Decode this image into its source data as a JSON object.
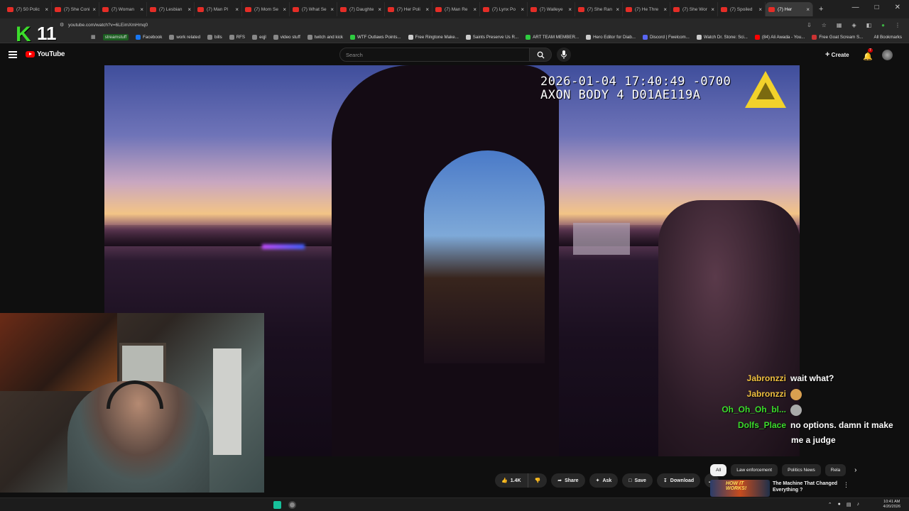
{
  "browser": {
    "tabs": [
      {
        "label": "(7) 50 Polic"
      },
      {
        "label": "(7) She Coni"
      },
      {
        "label": "(7) Woman"
      },
      {
        "label": "(7) Lesbian"
      },
      {
        "label": "(7) Man Pl"
      },
      {
        "label": "(7) Mom Se"
      },
      {
        "label": "(7) What Se"
      },
      {
        "label": "(7) Daughte"
      },
      {
        "label": "(7) Her Poli"
      },
      {
        "label": "(7) Man Re"
      },
      {
        "label": "(7) Lynx Po"
      },
      {
        "label": "(7) Walleye"
      },
      {
        "label": "(7) She Ran"
      },
      {
        "label": "(7) He Thre"
      },
      {
        "label": "(7) She Wor"
      },
      {
        "label": "(7) Spoiled"
      },
      {
        "label": "(7) Her"
      }
    ],
    "new_tab": "+",
    "url": "youtube.com/watch?v=6LEimXmHmq0",
    "bookmarks": [
      {
        "label": "streamstuff",
        "color": "#1b5e20"
      },
      {
        "label": "Facebook",
        "color": "#1877f2"
      },
      {
        "label": "work related",
        "color": "#888888"
      },
      {
        "label": "bills",
        "color": "#888888"
      },
      {
        "label": "RFS",
        "color": "#888888"
      },
      {
        "label": "eqjl",
        "color": "#888888"
      },
      {
        "label": "video stuff",
        "color": "#888888"
      },
      {
        "label": "twitch and kick",
        "color": "#888888"
      },
      {
        "label": "WTF Outlaws Points...",
        "color": "#2ecc40"
      },
      {
        "label": "Free Ringtone Make...",
        "color": "#cccccc"
      },
      {
        "label": "Saints Preserve Us R...",
        "color": "#cccccc"
      },
      {
        "label": "ART TEAM MEMBER...",
        "color": "#2ecc40"
      },
      {
        "label": "Hero Editor for Diab...",
        "color": "#cccccc"
      },
      {
        "label": "Discord | Fwelcom...",
        "color": "#5865f2"
      },
      {
        "label": "Watch Dr. Stone: Sci...",
        "color": "#cccccc"
      },
      {
        "label": "(84) Ali Awada - You...",
        "color": "#ff0000"
      },
      {
        "label": "Free Goat Scream S...",
        "color": "#cc3333"
      }
    ],
    "all_bookmarks": "All Bookmarks"
  },
  "overlay": {
    "k": "K",
    "num": "11"
  },
  "youtube": {
    "logo": "YouTube",
    "search_placeholder": "Search",
    "create_label": "Create",
    "notif_count": "7"
  },
  "video": {
    "timestamp": "2026-01-04 17:40:49 -0700",
    "device": "AXON BODY 4 D01AE119A"
  },
  "chat": [
    {
      "user": "Jabronzzi",
      "msg": "wait what?",
      "user_color": "#f0c040",
      "emote": ""
    },
    {
      "user": "Jabronzzi",
      "msg": "",
      "user_color": "#f0c040",
      "emote": "#d9a050"
    },
    {
      "user": "Oh_Oh_Oh_bl...",
      "msg": "",
      "user_color": "#3cdc2c",
      "emote": "#aaaaaa"
    },
    {
      "user": "Dolfs_Place",
      "msg": "no options. damn it make",
      "user_color": "#3cdc2c",
      "emote": ""
    },
    {
      "user": "",
      "msg": "me a judge",
      "user_color": "#ffffff",
      "emote": ""
    }
  ],
  "actions": {
    "like_count": "1.4K",
    "share": "Share",
    "ask": "Ask",
    "save": "Save",
    "download": "Download",
    "more": "…"
  },
  "chips": [
    "All",
    "Law enforcement",
    "Politics News",
    "Rela"
  ],
  "recommendation": {
    "thumb_text": "HOW IT WORKS!",
    "title": "The Machine That Changed Everything ?"
  },
  "taskbar": {
    "time": "10:41 AM",
    "date": "4/20/2026"
  }
}
